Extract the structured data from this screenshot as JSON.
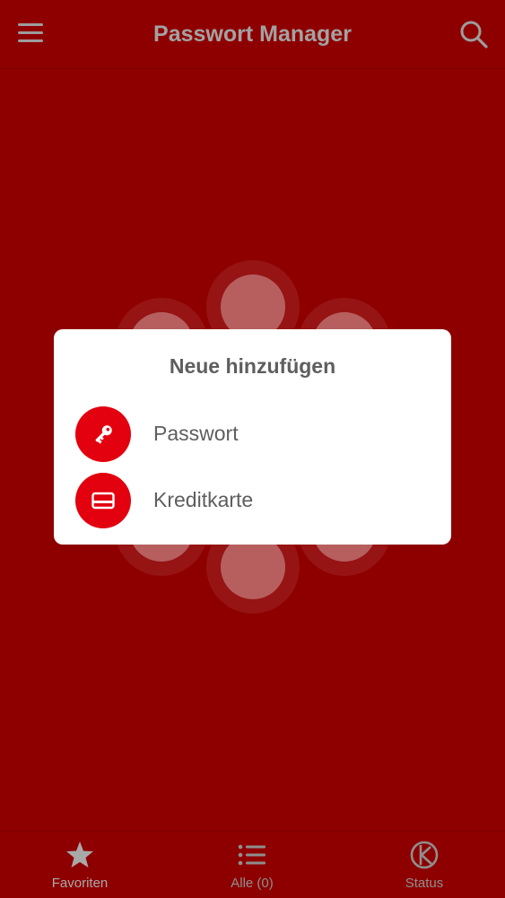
{
  "header": {
    "title": "Passwort Manager"
  },
  "dialog": {
    "title": "Neue hinzufügen",
    "options": [
      {
        "label": "Passwort",
        "icon": "key-icon"
      },
      {
        "label": "Kreditkarte",
        "icon": "credit-card-icon"
      }
    ]
  },
  "tabs": [
    {
      "label": "Favoriten",
      "icon": "star-icon",
      "active": true
    },
    {
      "label": "Alle (0)",
      "icon": "list-icon",
      "active": false
    },
    {
      "label": "Status",
      "icon": "status-icon",
      "active": false
    }
  ],
  "colors": {
    "background": "#8e0000",
    "accent": "#e3000f",
    "dialog": "#ffffff",
    "text": "#5e5e5e"
  }
}
